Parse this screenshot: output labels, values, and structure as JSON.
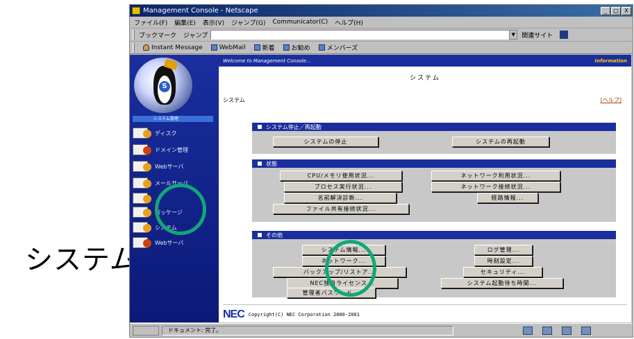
{
  "caption": "システム",
  "window": {
    "title": "Management Console - Netscape",
    "controls": [
      "_",
      "□",
      "X"
    ]
  },
  "menu": [
    "ファイル(F)",
    "編集(E)",
    "表示(V)",
    "ジャンプ(G)",
    "Communicator(C)",
    "ヘルプ(H)"
  ],
  "location": {
    "bookmarks": "ブックマーク",
    "jump": "ジャンプ",
    "url": "",
    "related": "関連サイト"
  },
  "personal": [
    "Instant Message",
    "WebMail",
    "新着",
    "お勧め",
    "メンバーズ"
  ],
  "sidebar": {
    "current": "システム管理",
    "items": [
      {
        "label": "ディスク"
      },
      {
        "label": "ドメイン管理"
      },
      {
        "label": "Webサーバ"
      },
      {
        "label": "メールサーバ"
      },
      {
        "label": ""
      },
      {
        "label": "パッケージ"
      },
      {
        "label": "システム"
      },
      {
        "label": "Webサーバ"
      }
    ]
  },
  "content": {
    "welcome": "Welcome to Management Console...",
    "info": "Information",
    "title": "システム",
    "breadcrumb": "システム",
    "help": "[ヘルプ]"
  },
  "panels": {
    "restart": {
      "title": "システム停止／再起動",
      "buttons": [
        "システムの停止",
        "システムの再起動"
      ]
    },
    "status": {
      "title": "状態",
      "buttons": [
        "CPU/メモリ使用状況...",
        "ネットワーク利用状況...",
        "プロセス実行状況...",
        "ネットワーク接続状況...",
        "名前解決診断...",
        "経路情報...",
        "ファイル共有接続状況..."
      ]
    },
    "other": {
      "title": "その他",
      "buttons": [
        "システム情報...",
        "ログ管理...",
        "ネットワーク...",
        "時刻設定...",
        "バックアップ/リストア...",
        "セキュリティ...",
        "NEC独自ライセンス...",
        "システム起動待ち時間...",
        "管理者パスワード..."
      ]
    }
  },
  "footer": {
    "brand": "NEC",
    "copyright": "Copyright(C) NEC Corporation 2000-2001"
  },
  "status": {
    "text": "ドキュメント: 完了。"
  }
}
